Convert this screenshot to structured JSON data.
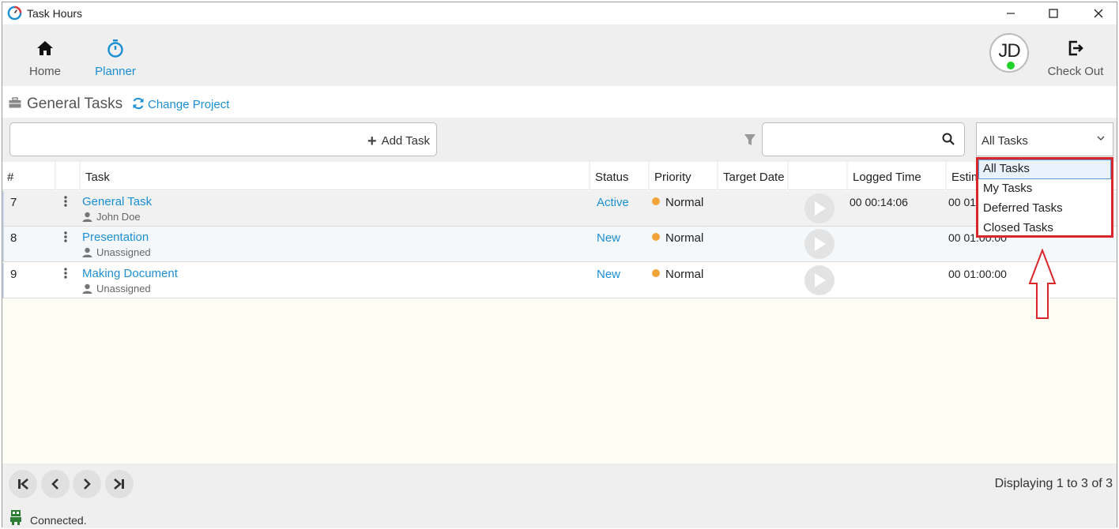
{
  "window": {
    "title": "Task Hours"
  },
  "nav": {
    "home_label": "Home",
    "planner_label": "Planner",
    "checkout_label": "Check Out",
    "avatar_initials": "JD",
    "avatar_status_color": "#22d12a"
  },
  "project": {
    "title": "General Tasks",
    "change_label": "Change Project"
  },
  "toolbar": {
    "add_task_value": "",
    "add_task_label": "Add Task",
    "search_value": "",
    "task_filter_selected": "All Tasks"
  },
  "table": {
    "columns": [
      "#",
      "",
      "Task",
      "Status",
      "Priority",
      "Target Date",
      "",
      "Logged Time",
      "Estim"
    ],
    "rows": [
      {
        "id": "7",
        "task": "General Task",
        "assignee": "John Doe",
        "status": "Active",
        "priority": "Normal",
        "target_date": "",
        "logged": "00 00:14:06",
        "estimate": "00 01"
      },
      {
        "id": "8",
        "task": "Presentation",
        "assignee": "Unassigned",
        "status": "New",
        "priority": "Normal",
        "target_date": "",
        "logged": "",
        "estimate": "00 01:00:00"
      },
      {
        "id": "9",
        "task": "Making Document",
        "assignee": "Unassigned",
        "status": "New",
        "priority": "Normal",
        "target_date": "",
        "logged": "",
        "estimate": "00 01:00:00"
      }
    ]
  },
  "dropdown": {
    "options": [
      "All Tasks",
      "My Tasks",
      "Deferred Tasks",
      "Closed Tasks"
    ],
    "highlight_color": "#d9262b"
  },
  "footer": {
    "displaying": "Displaying 1 to 3 of 3",
    "connection": "Connected."
  },
  "colors": {
    "accent": "#1b8fd4",
    "priority_normal": "#f2a33a",
    "annotation": "#d9262b"
  }
}
